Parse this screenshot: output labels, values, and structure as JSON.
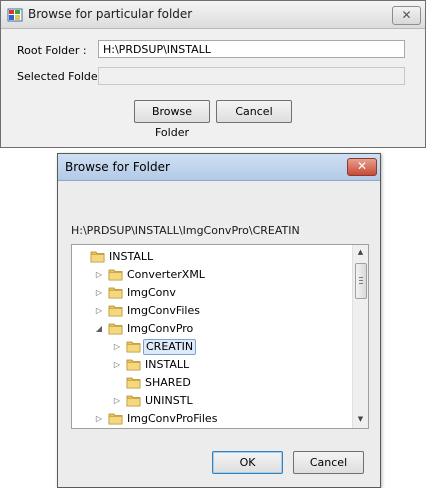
{
  "window_top": {
    "title": "Browse for particular folder",
    "close_glyph": "✕",
    "root_folder_label": "Root Folder :",
    "root_folder_value": "H:\\PRDSUP\\INSTALL",
    "selected_folder_label": "Selected Folder :",
    "selected_folder_value": "",
    "browse_button": "Browse Folder",
    "cancel_button": "Cancel"
  },
  "dialog": {
    "title": "Browse for Folder",
    "close_glyph": "✕",
    "path": "H:\\PRDSUP\\INSTALL\\ImgConvPro\\CREATIN",
    "tree": [
      {
        "label": "INSTALL",
        "arrow": ""
      },
      {
        "label": "ConverterXML",
        "arrow": "▷"
      },
      {
        "label": "ImgConv",
        "arrow": "▷"
      },
      {
        "label": "ImgConvFiles",
        "arrow": "▷"
      },
      {
        "label": "ImgConvPro",
        "arrow": "◢"
      },
      {
        "label": "CREATIN",
        "arrow": "▷"
      },
      {
        "label": "INSTALL",
        "arrow": "▷"
      },
      {
        "label": "SHARED",
        "arrow": ""
      },
      {
        "label": "UNINSTL",
        "arrow": "▷"
      },
      {
        "label": "ImgConvProFiles",
        "arrow": "▷"
      }
    ],
    "scroll_up": "▲",
    "scroll_down": "▼",
    "ok_button": "OK",
    "cancel_button": "Cancel"
  },
  "colors": {
    "folder": "#e8c25a",
    "selection": "#dceaf9",
    "dialog_title": "#b2c9e6"
  },
  "icons": {
    "app": "folder-app-icon",
    "folder": "folder-icon"
  }
}
